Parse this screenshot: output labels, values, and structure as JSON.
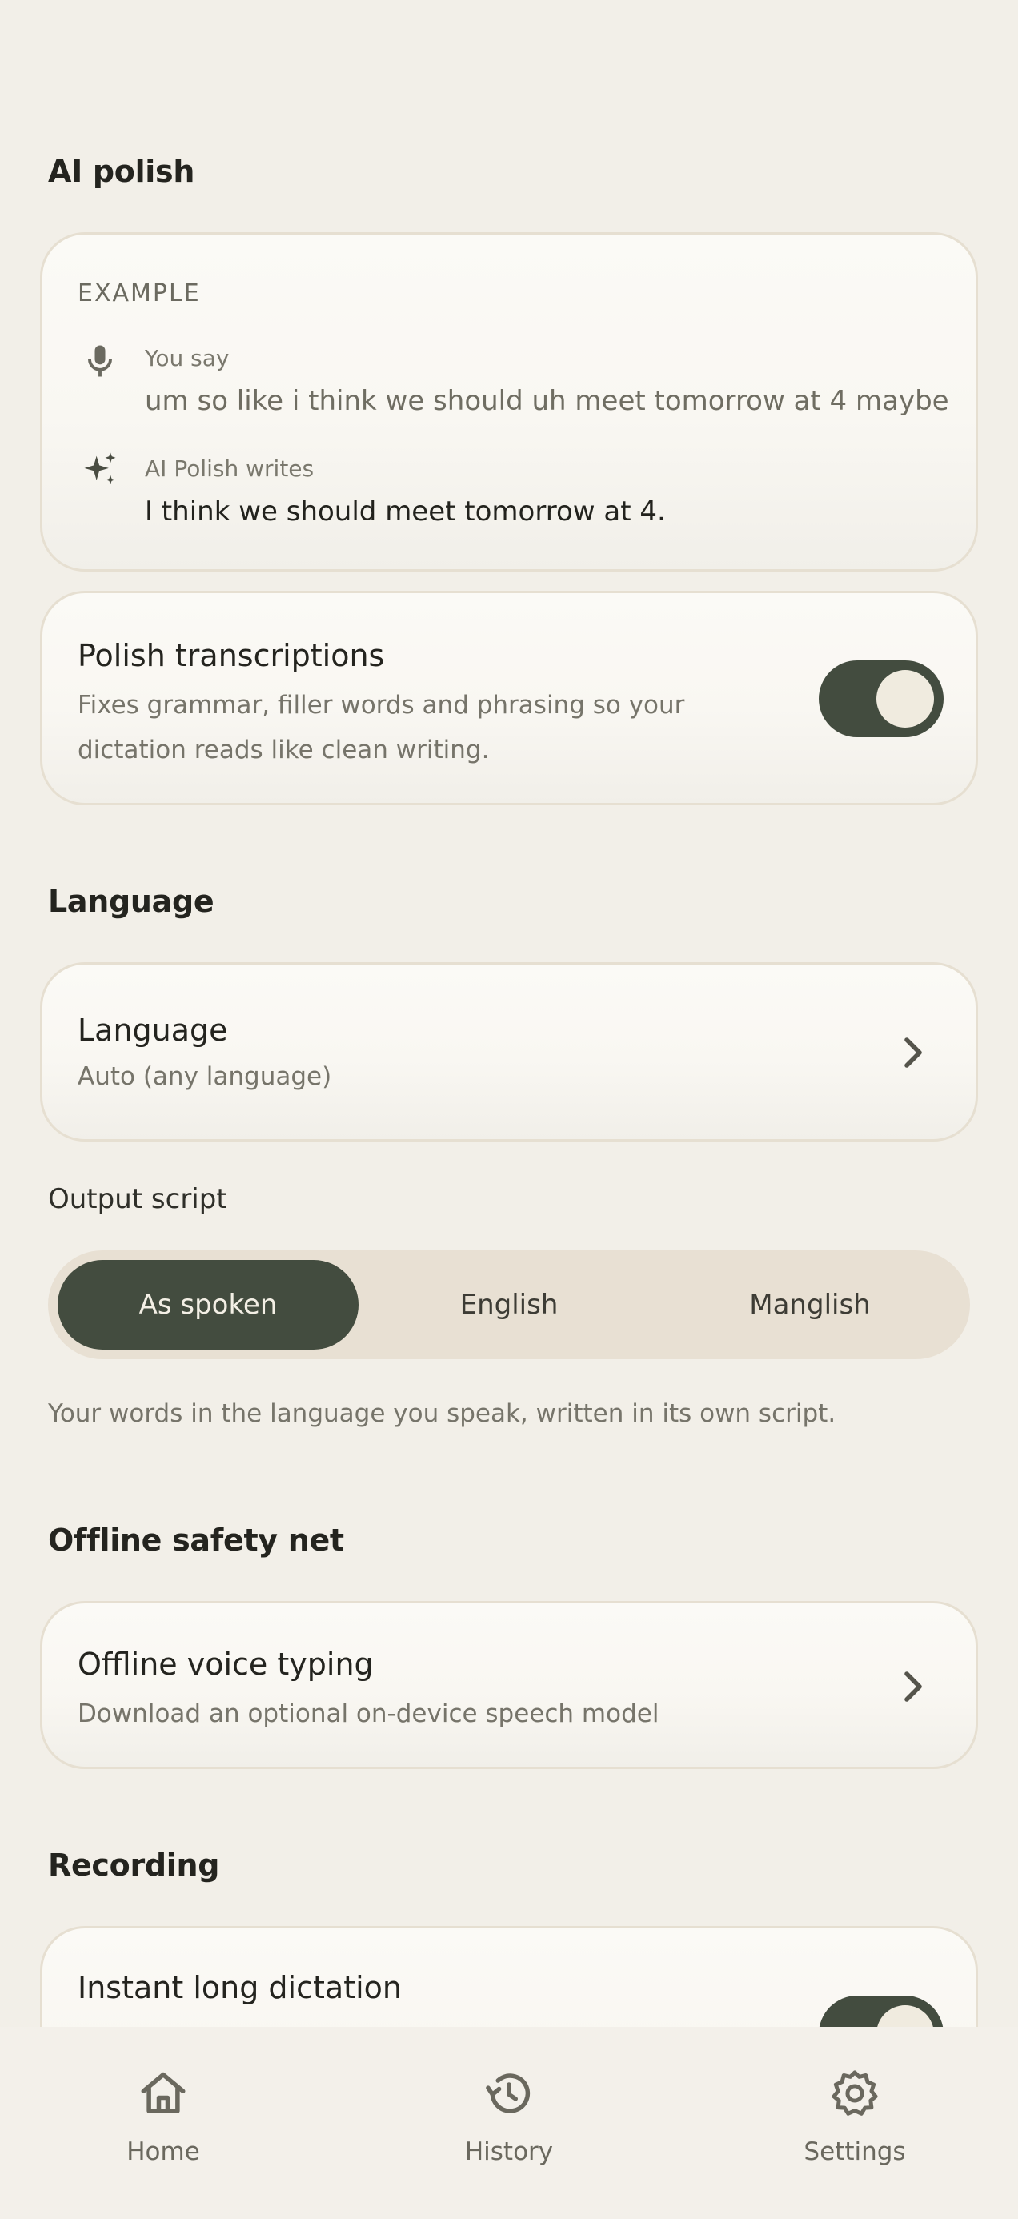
{
  "ai_polish": {
    "section_title": "AI polish",
    "example": {
      "label": "EXAMPLE",
      "you_say_label": "You say",
      "you_say_text": "um so like i think we should uh meet tomorrow at 4 maybe",
      "ai_label": "AI Polish writes",
      "ai_text": "I think we should meet tomorrow at 4."
    },
    "polish_toggle": {
      "title": "Polish transcriptions",
      "description_line1": "Fixes grammar, filler words and phrasing so your",
      "description_line2": "dictation reads like clean writing.",
      "enabled": true
    }
  },
  "language": {
    "section_title": "Language",
    "row": {
      "title": "Language",
      "value": "Auto (any language)"
    },
    "output_script_label": "Output script",
    "options": [
      "As spoken",
      "English",
      "Manglish"
    ],
    "selected": "As spoken",
    "helper": "Your words in the language you speak, written in its own script."
  },
  "offline": {
    "section_title": "Offline safety net",
    "row": {
      "title": "Offline voice typing",
      "subtitle": "Download an optional on-device speech model"
    }
  },
  "recording": {
    "section_title": "Recording",
    "instant_long": {
      "title": "Instant long dictation",
      "enabled": true
    }
  },
  "nav": {
    "items": [
      {
        "label": "Home",
        "icon": "home-icon"
      },
      {
        "label": "History",
        "icon": "history-icon"
      },
      {
        "label": "Settings",
        "icon": "settings-icon"
      }
    ]
  },
  "colors": {
    "background": "#f2efe8",
    "accent": "#434c3f",
    "card_border": "#e6dfd1",
    "segmented_bg": "#e8e0d3"
  }
}
